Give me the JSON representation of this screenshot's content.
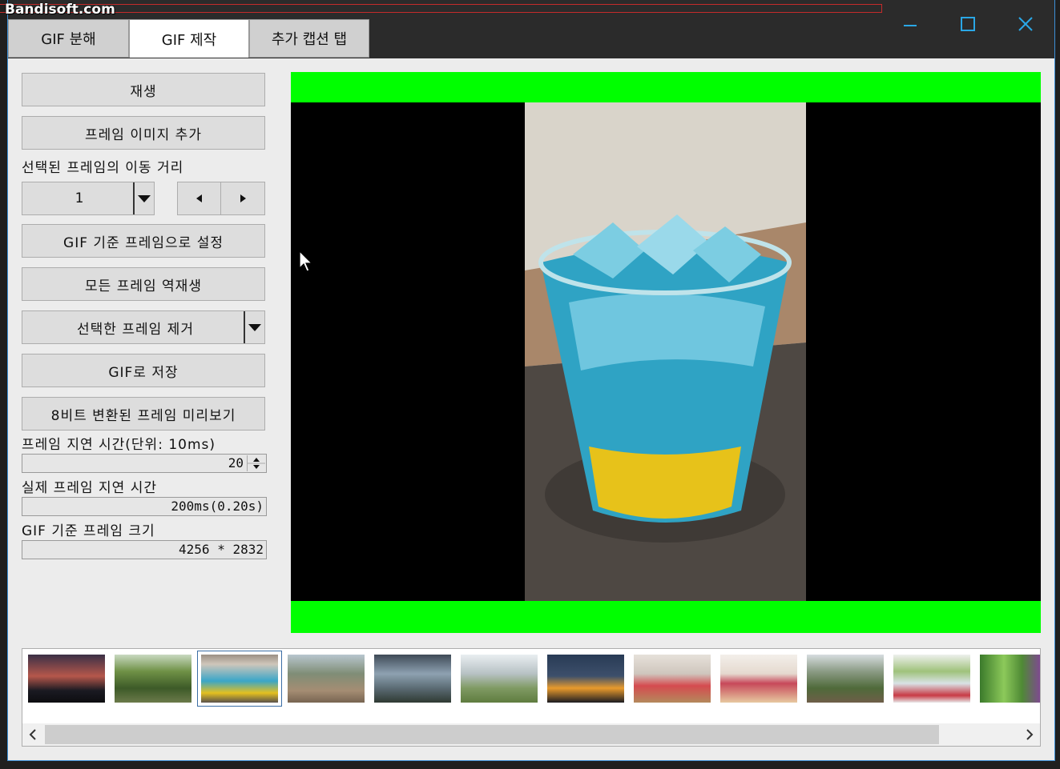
{
  "overlay": {
    "watermark": "Bandisoft.com"
  },
  "tabs": [
    {
      "label": "GIF 분해",
      "active": false
    },
    {
      "label": "GIF 제작",
      "active": true
    },
    {
      "label": "추가 캡션 탭",
      "active": false
    }
  ],
  "buttons": {
    "play": "재생",
    "add_frame": "프레임 이미지 추가",
    "set_base": "GIF 기준 프레임으로 설정",
    "reverse": "모든 프레임 역재생",
    "remove": "선택한 프레임 제거",
    "save": "GIF로 저장",
    "preview8": "8비트 변환된 프레임 미리보기"
  },
  "move": {
    "label": "선택된 프레임의 이동 거리",
    "value": "1"
  },
  "delay": {
    "label": "프레임 지연 시간(단위: 10ms)",
    "value": "20"
  },
  "actual_delay": {
    "label": "실제 프레임 지연 시간",
    "value": "200ms(0.20s)"
  },
  "base_size": {
    "label": "GIF 기준 프레임 크기",
    "value": "4256 * 2832"
  },
  "colors": {
    "accent": "#3c8fd6",
    "preview_bg": "#000000",
    "letterbox": "#00ff00",
    "window_control": "#2aa7e6"
  }
}
